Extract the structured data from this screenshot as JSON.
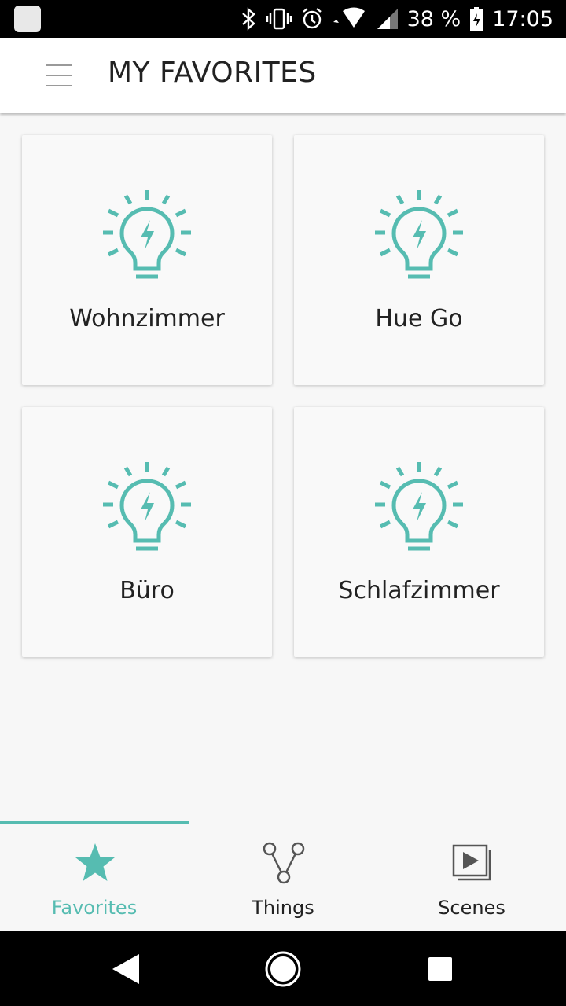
{
  "status_bar": {
    "battery": "38 %",
    "time": "17:05",
    "icons": [
      "notification-icon",
      "bluetooth-icon",
      "vibrate-icon",
      "alarm-icon",
      "wifi-icon",
      "signal-icon",
      "battery-icon"
    ]
  },
  "header": {
    "title": "MY FAVORITES",
    "menu_icon": "hamburger-menu-icon"
  },
  "favorites": [
    {
      "label": "Wohnzimmer",
      "icon": "lightbulb-icon"
    },
    {
      "label": "Hue Go",
      "icon": "lightbulb-icon"
    },
    {
      "label": "Büro",
      "icon": "lightbulb-icon"
    },
    {
      "label": "Schlafzimmer",
      "icon": "lightbulb-icon"
    }
  ],
  "bottom_nav": {
    "active": "Favorites",
    "items": [
      {
        "label": "Favorites",
        "icon": "star-icon"
      },
      {
        "label": "Things",
        "icon": "nodes-icon"
      },
      {
        "label": "Scenes",
        "icon": "scenes-icon"
      }
    ]
  },
  "colors": {
    "accent": "#56bcb1",
    "text": "#222222",
    "background": "#f7f7f7"
  }
}
